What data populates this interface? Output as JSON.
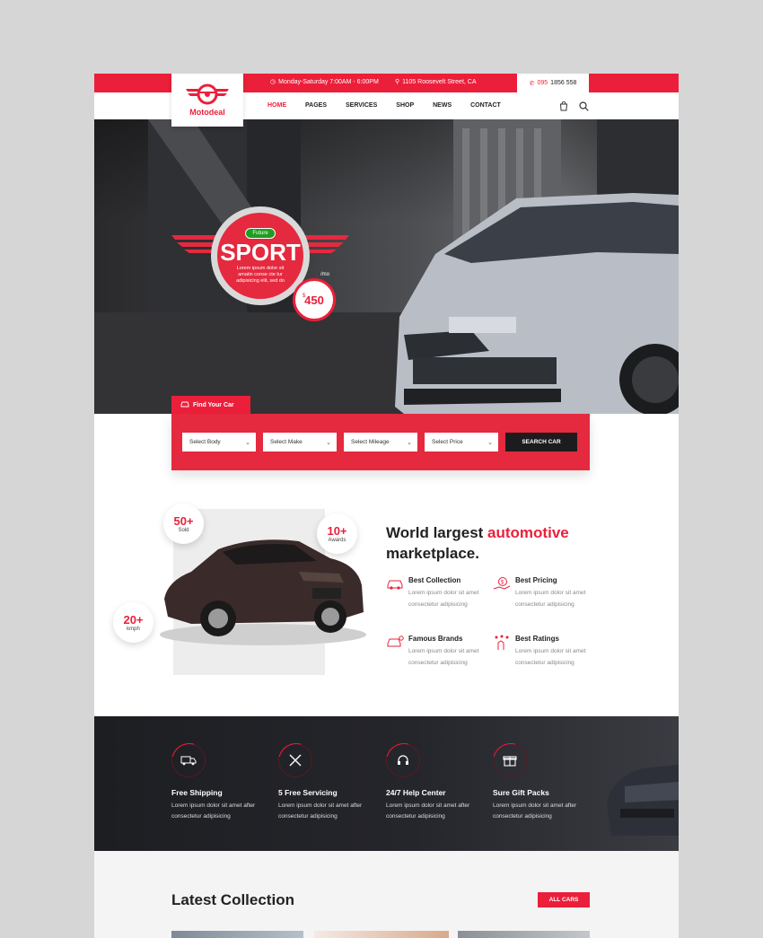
{
  "topbar": {
    "hours": "Monday-Saturday 7:00AM - 6:00PM",
    "address": "1105 Roosevelt Street, CA",
    "phone_prefix": "095",
    "phone_rest": "1856 558"
  },
  "brand": {
    "name": "Motodeal"
  },
  "nav": {
    "items": [
      "HOME",
      "PAGES",
      "SERVICES",
      "SHOP",
      "NEWS",
      "CONTACT"
    ]
  },
  "hero": {
    "tag": "Future",
    "headline": "SPORT",
    "subtext": "Lorem ipsum dolor sit amatin conse cte tur adipisicing elit, sed do",
    "price_currency": "$",
    "price": "450",
    "price_period": "/mo"
  },
  "search": {
    "tab_label": "Find Your Car",
    "selects": [
      "Select Body",
      "Select Make",
      "Select Mileage",
      "Select Price"
    ],
    "button": "SEARCH CAR"
  },
  "about": {
    "stats": [
      {
        "num": "50+",
        "label": "Sold"
      },
      {
        "num": "10+",
        "label": "Awards"
      },
      {
        "num": "20+",
        "label": "kmph"
      }
    ],
    "title_start": "World largest ",
    "title_highlight": "automotive",
    "title_end": "marketplace.",
    "features": [
      {
        "title": "Best Collection",
        "text": "Lorem ipsum dolor sit amet consectetur adipisicing"
      },
      {
        "title": "Best Pricing",
        "text": "Lorem ipsum dolor sit amet consectetur adipisicing"
      },
      {
        "title": "Famous Brands",
        "text": "Lorem ipsum dolor sit amet consectetur adipisicing"
      },
      {
        "title": "Best Ratings",
        "text": "Lorem ipsum dolor sit amet consectetur adipisicing"
      }
    ]
  },
  "services": [
    {
      "title": "Free Shipping",
      "text": "Lorem ipsum dolor sit amet after consectetur adipisicing"
    },
    {
      "title": "5 Free Servicing",
      "text": "Lorem ipsum dolor sit amet after consectetur adipisicing"
    },
    {
      "title": "24/7 Help Center",
      "text": "Lorem ipsum dolor sit amet after consectetur adipisicing"
    },
    {
      "title": "Sure Gift Packs",
      "text": "Lorem ipsum dolor sit amet after consectetur adipisicing"
    }
  ],
  "latest": {
    "title": "Latest Collection",
    "button": "ALL CARS"
  },
  "colors": {
    "accent": "#ec1f3a",
    "dark": "#1c1c1e"
  }
}
